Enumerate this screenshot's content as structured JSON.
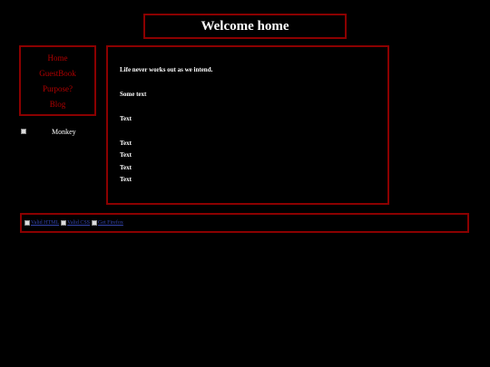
{
  "header": {
    "title": "Welcome home"
  },
  "nav": {
    "items": [
      {
        "label": "Home"
      },
      {
        "label": "GuestBook"
      },
      {
        "label": "Purpose?"
      },
      {
        "label": "Blog"
      }
    ]
  },
  "sidebar": {
    "image_label": "Monkey"
  },
  "main": {
    "lines": [
      "Life never works out as we intend.",
      "Some text",
      "Text",
      "Text",
      "Text",
      "Text",
      "Text"
    ]
  },
  "footer": {
    "badges": [
      {
        "alt": "Valid HTML"
      },
      {
        "alt": "Valid CSS"
      },
      {
        "alt": "Get Firefox"
      }
    ]
  },
  "colors": {
    "background": "#000000",
    "border": "#8b0000",
    "nav_link": "#b00000",
    "text": "#ffffff"
  }
}
